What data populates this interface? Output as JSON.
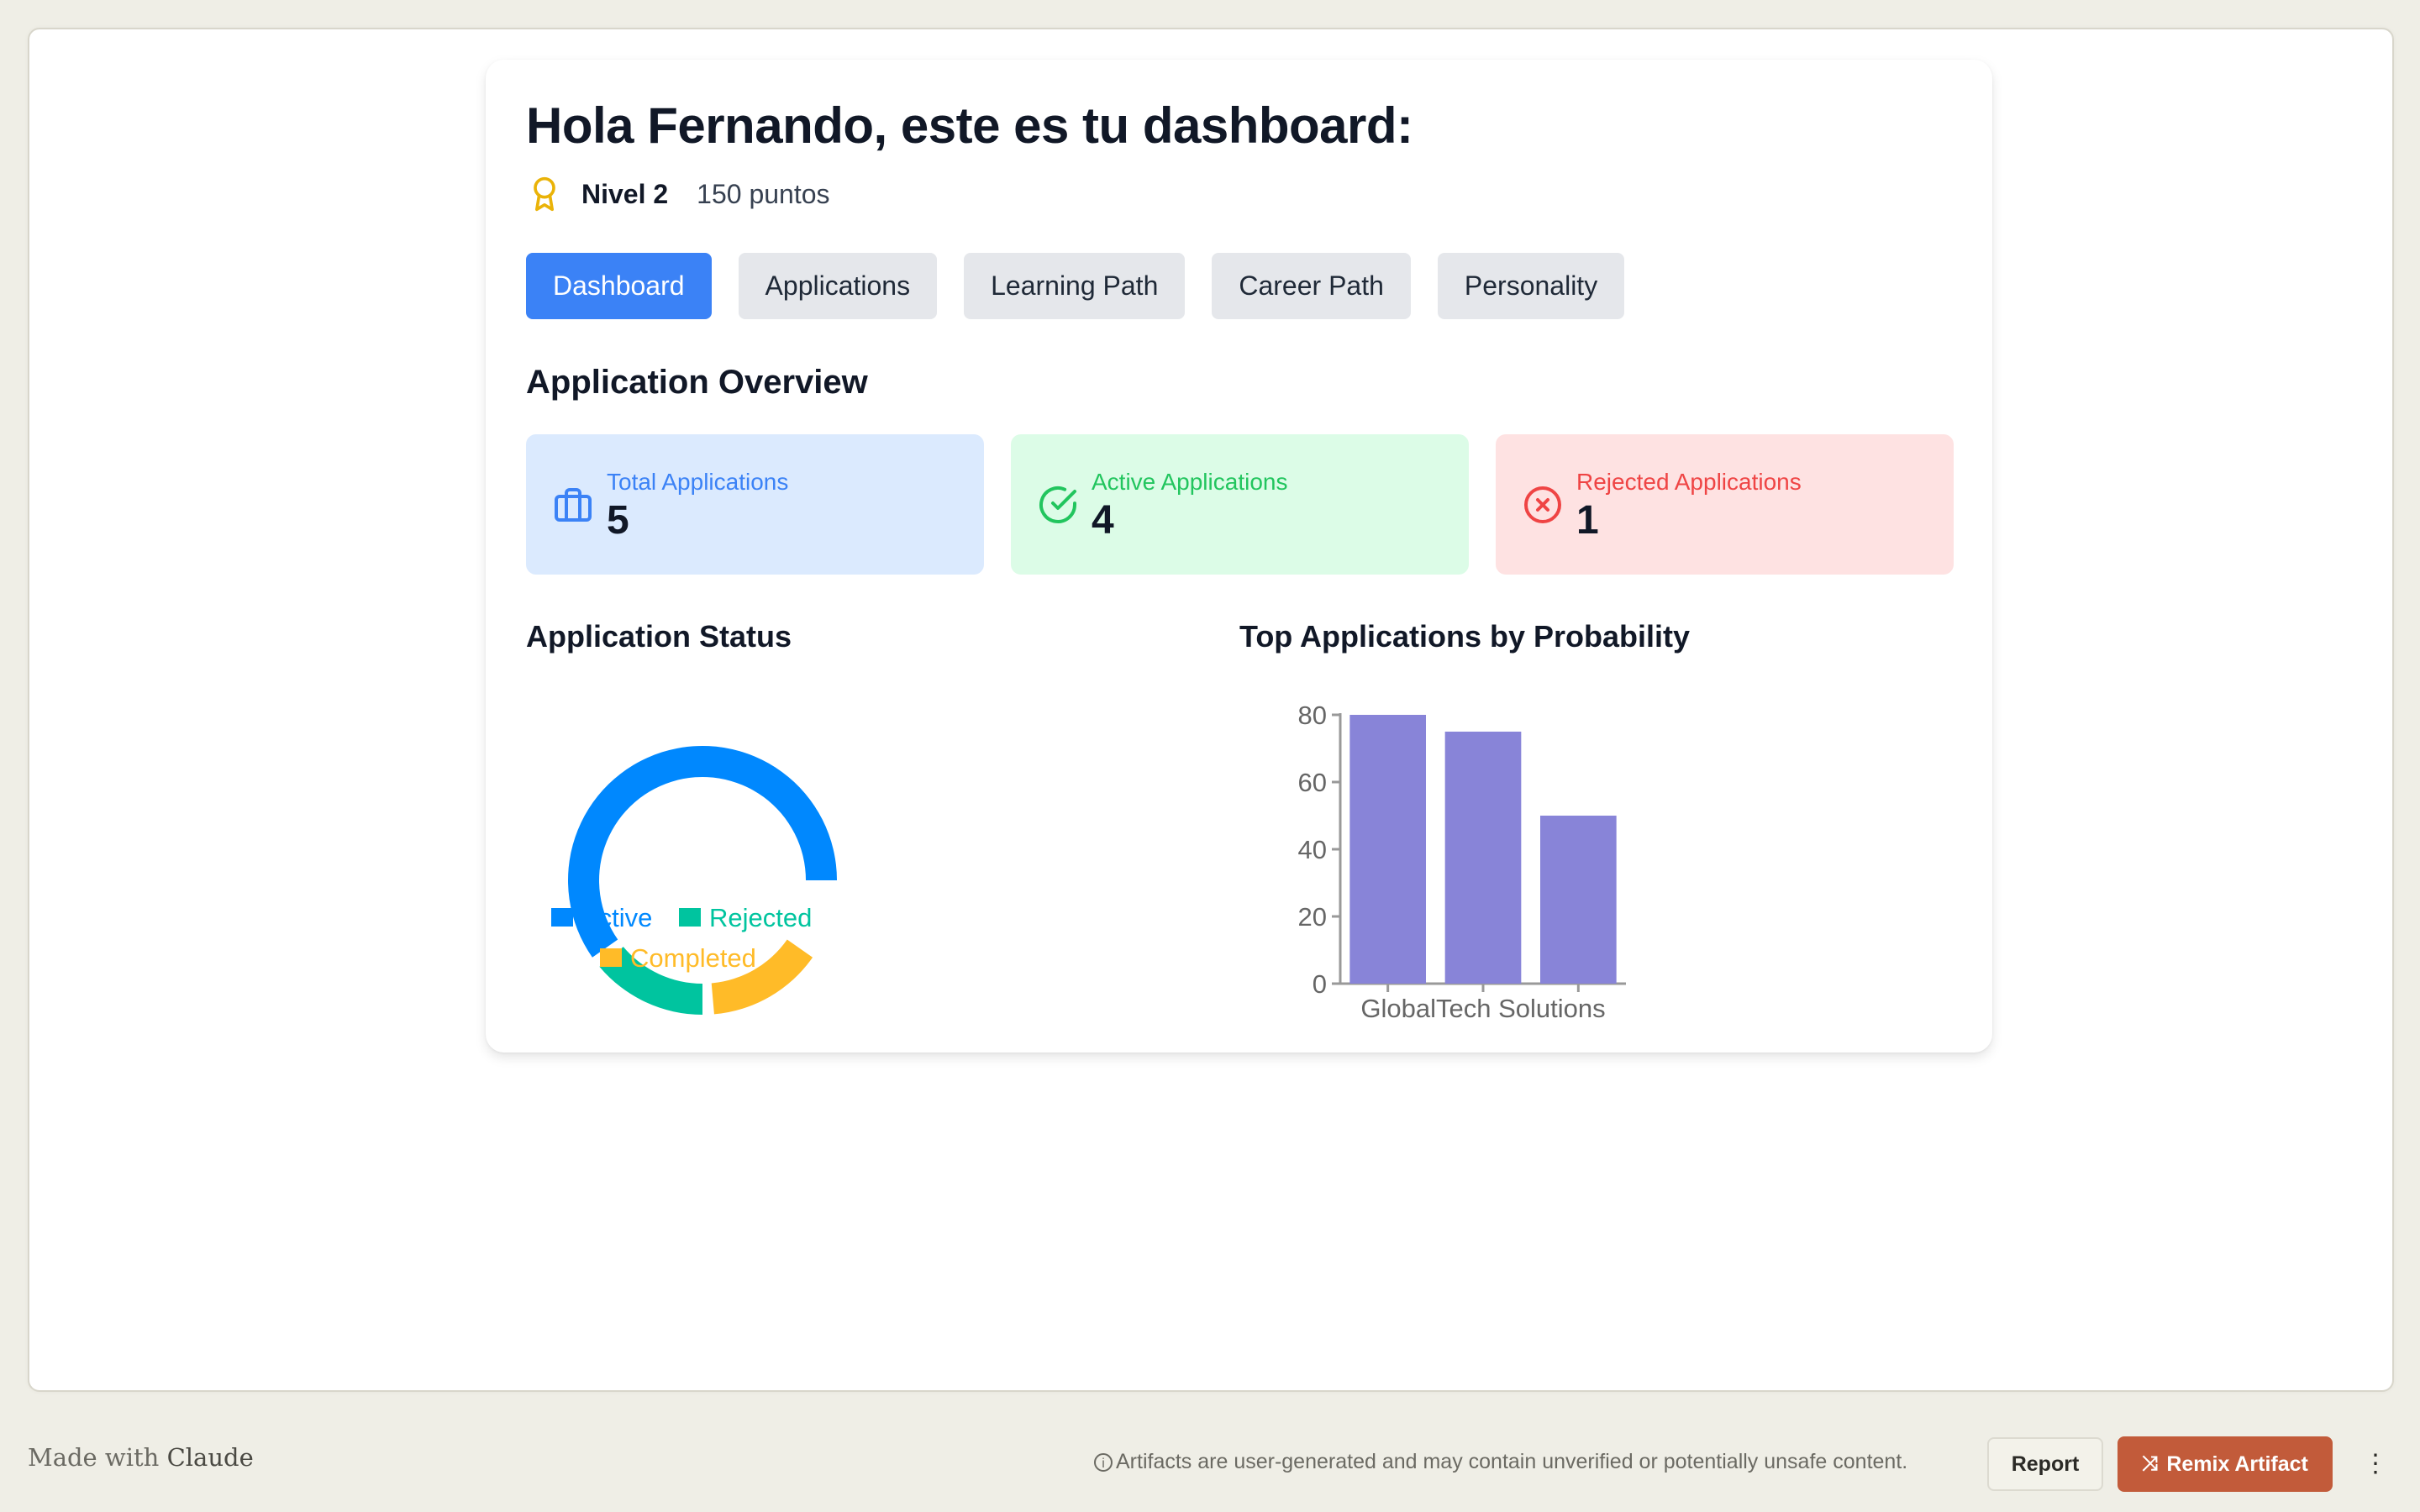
{
  "header": {
    "title": "Hola Fernando, este es tu dashboard:",
    "level": "Nivel 2",
    "points": "150 puntos",
    "level_icon": "award-icon",
    "level_icon_color": "#EAB308"
  },
  "tabs": [
    {
      "label": "Dashboard",
      "active": true
    },
    {
      "label": "Applications",
      "active": false
    },
    {
      "label": "Learning Path",
      "active": false
    },
    {
      "label": "Career Path",
      "active": false
    },
    {
      "label": "Personality",
      "active": false
    }
  ],
  "overview": {
    "title": "Application Overview",
    "stats": [
      {
        "label": "Total Applications",
        "value": "5",
        "icon": "briefcase-icon",
        "color": "#3B82F6"
      },
      {
        "label": "Active Applications",
        "value": "4",
        "icon": "check-circle-icon",
        "color": "#22C55E"
      },
      {
        "label": "Rejected Applications",
        "value": "1",
        "icon": "x-circle-icon",
        "color": "#EF4444"
      }
    ]
  },
  "chart_data": [
    {
      "type": "pie",
      "title": "Application Status",
      "labels": [
        "Active",
        "Rejected",
        "Completed"
      ],
      "values": [
        4,
        1,
        1
      ],
      "colors": [
        "#0088FE",
        "#00C49F",
        "#FFBB28"
      ],
      "legend": "bottom"
    },
    {
      "type": "bar",
      "title": "Top Applications by Probability",
      "categories": [
        "",
        "GlobalTech Solutions",
        ""
      ],
      "values": [
        80,
        75,
        50
      ],
      "color": "#8884D8",
      "yticks": [
        0,
        20,
        40,
        60,
        80
      ],
      "ylim": [
        0,
        80
      ],
      "xlabel": "",
      "ylabel": ""
    }
  ],
  "footer": {
    "made_with": "Made with",
    "brand": "Claude",
    "disclaimer": "Artifacts are user-generated and may contain unverified or potentially unsafe content.",
    "report_label": "Report",
    "remix_label": "Remix Artifact"
  }
}
